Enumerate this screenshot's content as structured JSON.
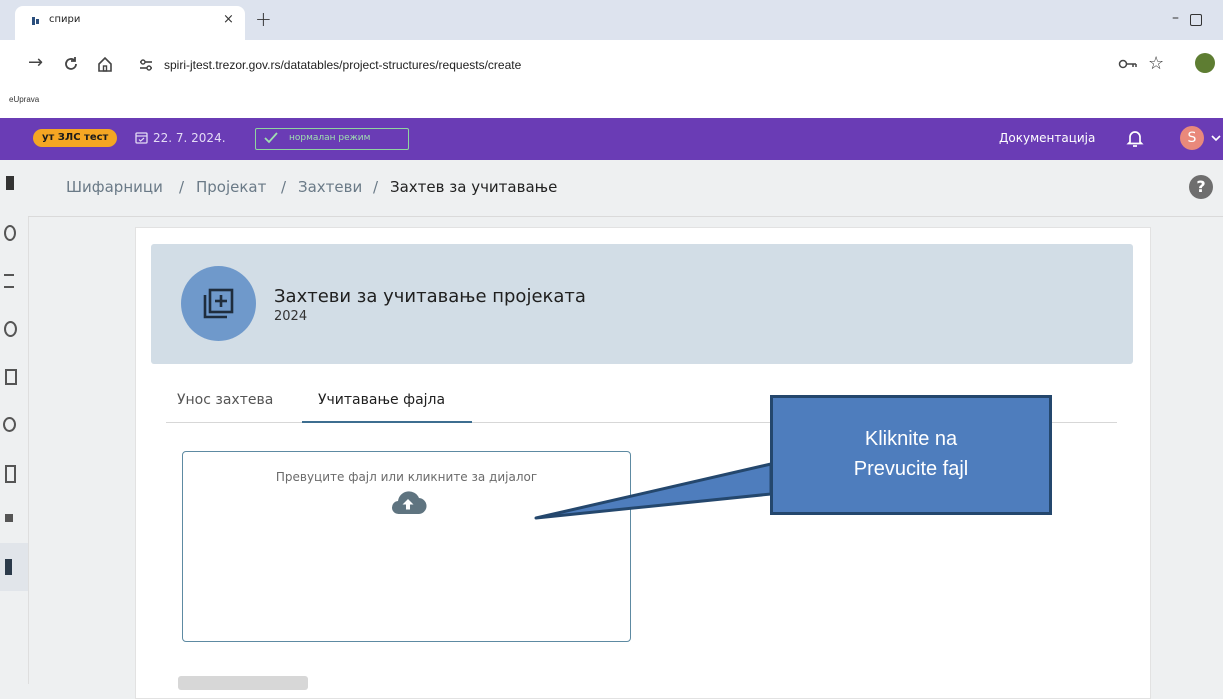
{
  "browser": {
    "tab_title": "спири",
    "url": "spiri-jtest.trezor.gov.rs/datatables/project-structures/requests/create",
    "bookmark": "eUprava",
    "new_tab_icon": "+",
    "close_icon": "×",
    "minimize_icon": "–"
  },
  "appbar": {
    "env_badge": "ут ЗЛС тест",
    "date": "22. 7. 2024.",
    "mode": "нормалан режим",
    "docs_link": "Документација",
    "avatar_initial": "S",
    "accent_color": "#6a3cb5"
  },
  "breadcrumb": {
    "items": [
      "Шифарници",
      "Пројекат",
      "Захтеви"
    ],
    "separator": "/",
    "current": "Захтев за учитавање"
  },
  "help_icon": "?",
  "card": {
    "title": "Захтеви за учитавање пројеката",
    "subtitle": "2024"
  },
  "tabs": [
    {
      "label": "Унос захтева",
      "active": false
    },
    {
      "label": "Учитавање фајла",
      "active": true
    }
  ],
  "dropzone": {
    "text": "Превуците фајл или кликните за дијалог",
    "icon": "cloud-upload-icon"
  },
  "callout": {
    "line1": "Kliknite na",
    "line2": "Prevucite fajl"
  }
}
